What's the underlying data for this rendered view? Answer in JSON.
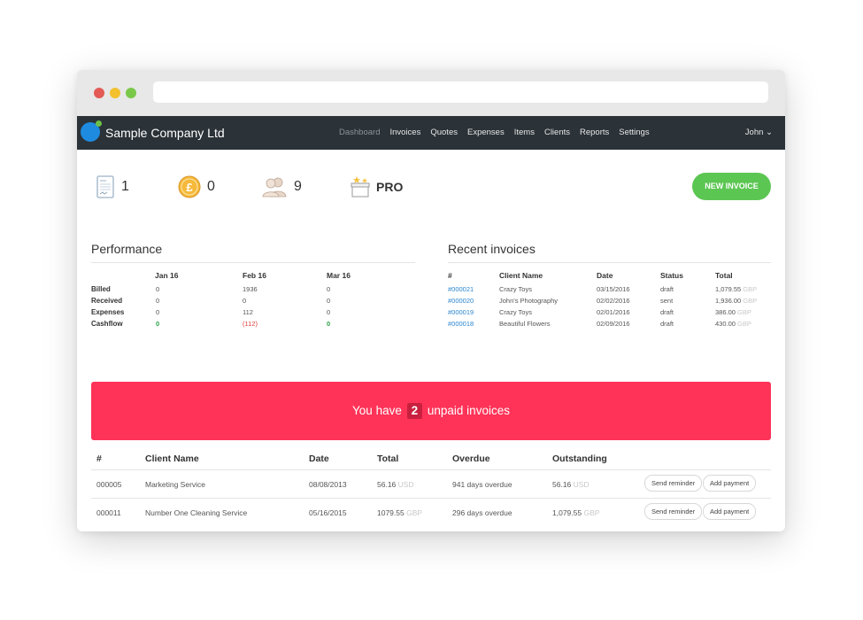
{
  "app": {
    "brand": "Sample Company Ltd",
    "user": "John ⌄"
  },
  "nav": [
    "Dashboard",
    "Invoices",
    "Quotes",
    "Expenses",
    "Items",
    "Clients",
    "Reports",
    "Settings"
  ],
  "stats": {
    "invoices_count": "1",
    "payments_count": "0",
    "clients_count": "9",
    "plan": "PRO"
  },
  "actions": {
    "new_invoice": "NEW INVOICE"
  },
  "performance": {
    "title": "Performance",
    "columns": [
      "Jan 16",
      "Feb 16",
      "Mar 16"
    ],
    "rows": [
      {
        "label": "Billed",
        "values": [
          "0",
          "1936",
          "0"
        ]
      },
      {
        "label": "Received",
        "values": [
          "0",
          "0",
          "0"
        ]
      },
      {
        "label": "Expenses",
        "values": [
          "0",
          "112",
          "0"
        ]
      },
      {
        "label": "Cashflow",
        "values": [
          "0",
          "(112)",
          "0"
        ]
      }
    ]
  },
  "recent": {
    "title": "Recent invoices",
    "headers": [
      "#",
      "Client Name",
      "Date",
      "Status",
      "Total"
    ],
    "rows": [
      {
        "id": "#000021",
        "client": "Crazy Toys",
        "date": "03/15/2016",
        "status": "draft",
        "total": "1,079.55",
        "currency": "GBP"
      },
      {
        "id": "#000020",
        "client": "John's Photography",
        "date": "02/02/2016",
        "status": "sent",
        "total": "1,936.00",
        "currency": "GBP"
      },
      {
        "id": "#000019",
        "client": "Crazy Toys",
        "date": "02/01/2016",
        "status": "draft",
        "total": "386.00",
        "currency": "GBP"
      },
      {
        "id": "#000018",
        "client": "Beautiful Flowers",
        "date": "02/09/2016",
        "status": "draft",
        "total": "430.00",
        "currency": "GBP"
      }
    ]
  },
  "unpaid": {
    "banner_prefix": "You have",
    "count": "2",
    "banner_suffix": "unpaid invoices",
    "headers": [
      "#",
      "Client Name",
      "Date",
      "Total",
      "Overdue",
      "Outstanding"
    ],
    "rows": [
      {
        "id": "000005",
        "client": "Marketing Service",
        "date": "08/08/2013",
        "total": "56.16",
        "total_currency": "USD",
        "overdue": "941 days overdue",
        "outstanding": "56.16",
        "outstanding_currency": "USD",
        "reminder": "Send reminder",
        "payment": "Add payment"
      },
      {
        "id": "000011",
        "client": "Number One Cleaning Service",
        "date": "05/16/2015",
        "total": "1079.55",
        "total_currency": "GBP",
        "overdue": "296 days overdue",
        "outstanding": "1,079.55",
        "outstanding_currency": "GBP",
        "reminder": "Send reminder",
        "payment": "Add payment"
      }
    ]
  },
  "colors": {
    "navbar": "#2b3238",
    "accent_green": "#5cc653",
    "banner_red": "#ff3358",
    "link_blue": "#2a85d0"
  }
}
